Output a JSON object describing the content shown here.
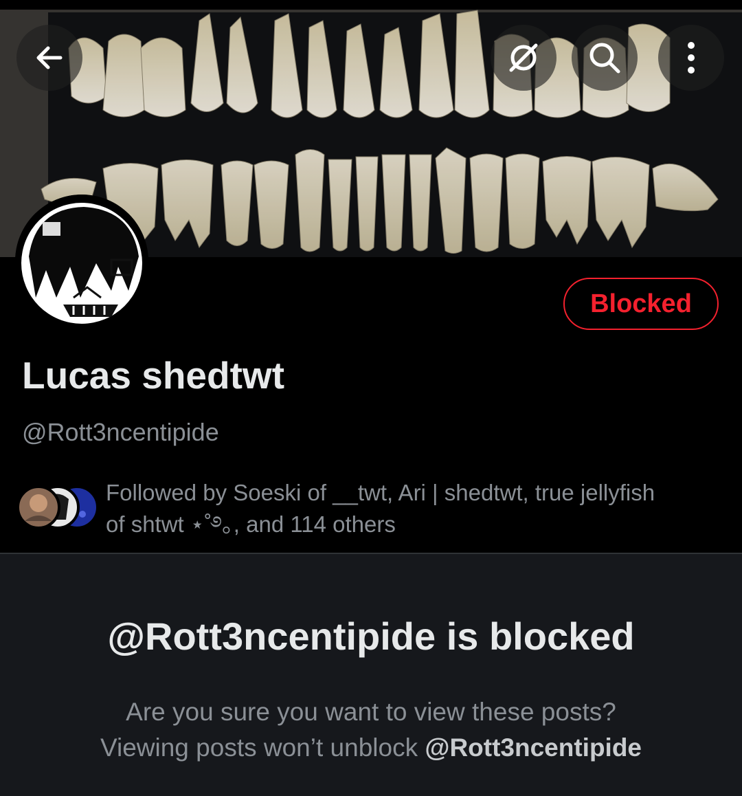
{
  "header": {
    "back_icon": "arrow-left-icon",
    "grok_icon": "grok-icon",
    "search_icon": "search-icon",
    "more_icon": "more-vertical-icon"
  },
  "banner": {
    "description_icon": "teeth-photo-banner"
  },
  "profile": {
    "display_name": "Lucas shedtwt",
    "handle": "@Rott3ncentipide",
    "blocked_button_label": "Blocked",
    "followed_by_line1": "Followed by Soeski of __twt, Ari | shedtwt, true jellyfish",
    "followed_by_line2": "of shtwt ⋆˚࿔｡, and 114 others"
  },
  "blocked_notice": {
    "title": "@Rott3ncentipide is blocked",
    "line1": "Are you sure you want to view these posts?",
    "line2_prefix": "Viewing posts won’t unblock ",
    "line2_handle": "@Rott3ncentipide"
  },
  "colors": {
    "background": "#000000",
    "blocked_red": "#f4212e",
    "secondary_text": "#8b9096",
    "panel": "#16181c"
  }
}
